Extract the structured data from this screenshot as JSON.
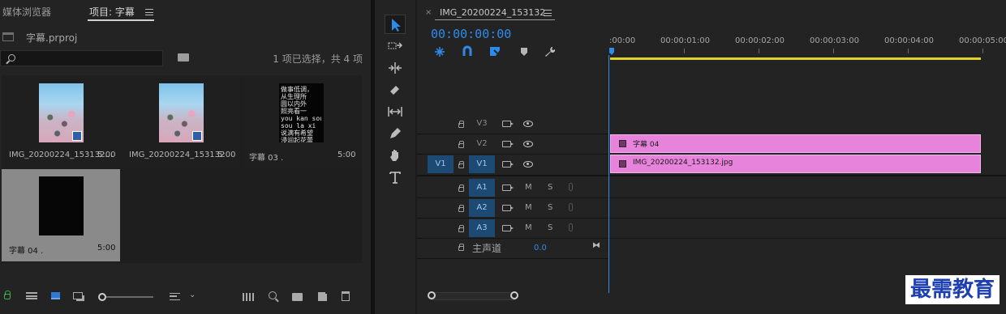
{
  "project_panel": {
    "tabs": [
      {
        "label": "媒体浏览器",
        "active": false
      },
      {
        "label": "项目: 字幕",
        "active": true
      }
    ],
    "project_file": "字幕.prproj",
    "search_placeholder": "",
    "selection_info": "1 项已选择，共 4 项",
    "items": [
      {
        "name": "IMG_20200224_153132...",
        "duration": "5:00",
        "kind": "photo",
        "selected": false
      },
      {
        "name": "IMG_20200224_153132",
        "duration": "5:00",
        "kind": "photo",
        "selected": false
      },
      {
        "name": "字幕 03    .",
        "duration": "5:00",
        "kind": "caption",
        "selected": false
      },
      {
        "name": "字幕 04    .",
        "duration": "5:00",
        "kind": "dark",
        "selected": true
      }
    ],
    "caption_preview": "做事低调，\n从生理所\n圆以内外\n照亮看一\nyou kan sou\nsou la xi\n说满有希望\n浸润起花蕾\n等您细读\n分读时光"
  },
  "tools": [
    {
      "name": "selection-tool",
      "active": true
    },
    {
      "name": "track-select-tool",
      "active": false
    },
    {
      "name": "ripple-edit-tool",
      "active": false
    },
    {
      "name": "razor-tool",
      "active": false
    },
    {
      "name": "slip-tool",
      "active": false
    },
    {
      "name": "pen-tool",
      "active": false
    },
    {
      "name": "hand-tool",
      "active": false
    },
    {
      "name": "type-tool",
      "active": false
    }
  ],
  "timeline": {
    "close_glyph": "×",
    "sequence_name": "IMG_20200224_153132",
    "timecode": "00:00:00:00",
    "ruler": [
      ":00:00",
      "00:00:01:00",
      "00:00:02:00",
      "00:00:03:00",
      "00:00:04:00",
      "00:00:05:00"
    ],
    "video_tracks": [
      {
        "id": "V3",
        "source_patch": "",
        "clip": null
      },
      {
        "id": "V2",
        "source_patch": "",
        "clip": "字幕 04"
      },
      {
        "id": "V1",
        "source_patch": "V1",
        "clip": "IMG_20200224_153132.jpg"
      }
    ],
    "audio_tracks": [
      {
        "id": "A1",
        "m": "M",
        "s": "S"
      },
      {
        "id": "A2",
        "m": "M",
        "s": "S"
      },
      {
        "id": "A3",
        "m": "M",
        "s": "S"
      }
    ],
    "master": {
      "label": "主声道",
      "value": "0.0"
    },
    "clip_color": "#e783db",
    "accent_color": "#2d8ceb",
    "workarea_color": "#e1d12b"
  },
  "watermark": "最需教育"
}
